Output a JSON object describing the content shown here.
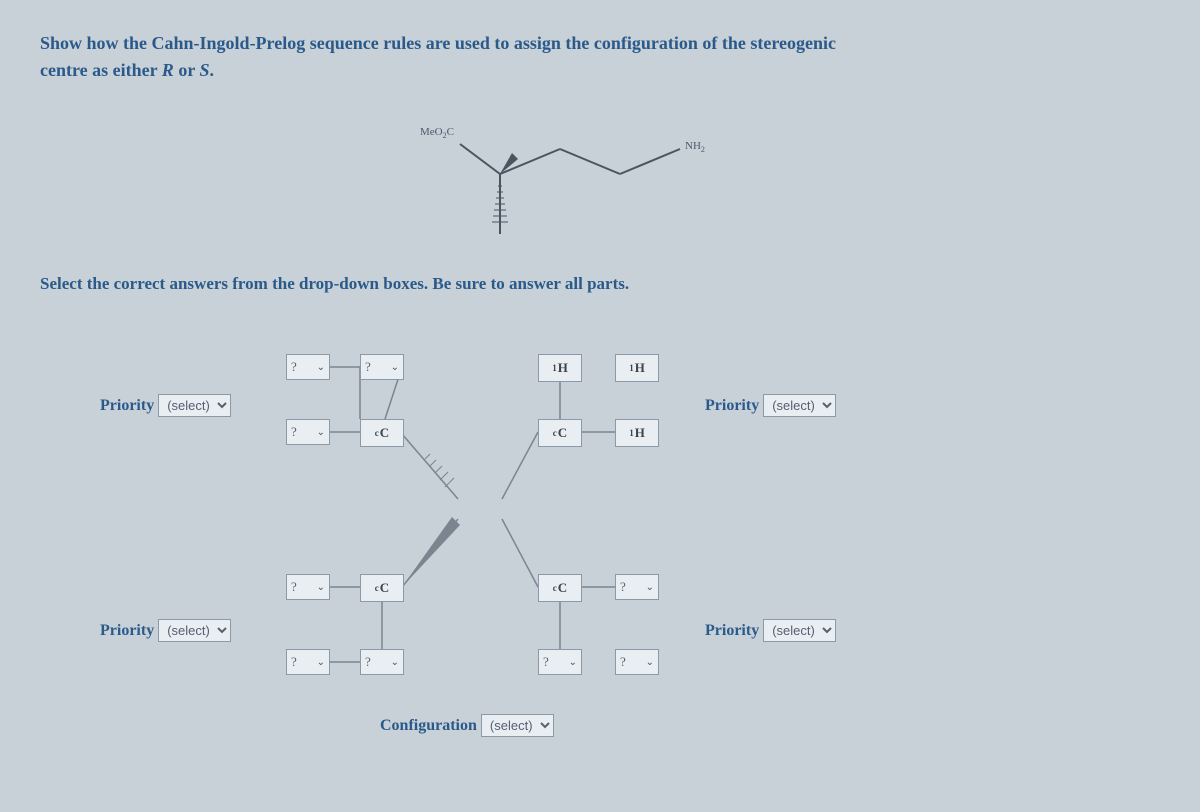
{
  "question_line1": "Show how the Cahn-Ingold-Prelog sequence rules are used to assign the configuration of the stereogenic",
  "question_line2_a": "centre as either ",
  "question_line2_r": "R",
  "question_line2_or": " or ",
  "question_line2_s": "S",
  "question_line2_end": ".",
  "molecule": {
    "meo2c": "MeO₂C",
    "nh2": "NH₂"
  },
  "instruction": "Select the correct answers from the drop-down boxes. Be sure to answer all parts.",
  "priority_label": "Priority",
  "select_placeholder": "(select)",
  "dropdown_q": "?",
  "atoms": {
    "h1": "¹H",
    "cc": "ᶜC"
  },
  "configuration_label": "Configuration"
}
